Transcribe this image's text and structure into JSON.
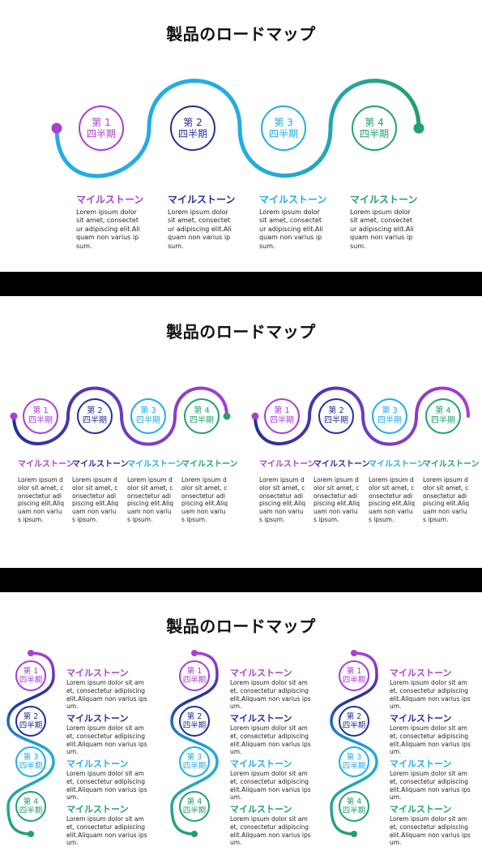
{
  "title": "製品のロードマップ",
  "colors": {
    "purple": "#a93fd0",
    "navy": "#233094",
    "cyan": "#22ade2",
    "green": "#24a06e"
  },
  "milestones": [
    {
      "line1": "第 1",
      "line2": "四半期",
      "label": "マイルストーン",
      "desc": "Lorem ipsum dolor sit amet, consectetur adipiscing elit.Aliquam non varius ipsum.",
      "color": "#a93fd0"
    },
    {
      "line1": "第 2",
      "line2": "四半期",
      "label": "マイルストーン",
      "desc": "Lorem ipsum dolor sit amet, consectetur adipiscing elit.Aliquam non varius ipsum.",
      "color": "#233094"
    },
    {
      "line1": "第 3",
      "line2": "四半期",
      "label": "マイルストーン",
      "desc": "Lorem ipsum dolor sit amet, consectetur adipiscing elit.Aliquam non varius ipsum.",
      "color": "#22ade2"
    },
    {
      "line1": "第 4",
      "line2": "四半期",
      "label": "マイルストーン",
      "desc": "Lorem ipsum dolor sit amet, consectetur adipiscing elit.Aliquam non varius ipsum.",
      "color": "#24a06e"
    }
  ]
}
